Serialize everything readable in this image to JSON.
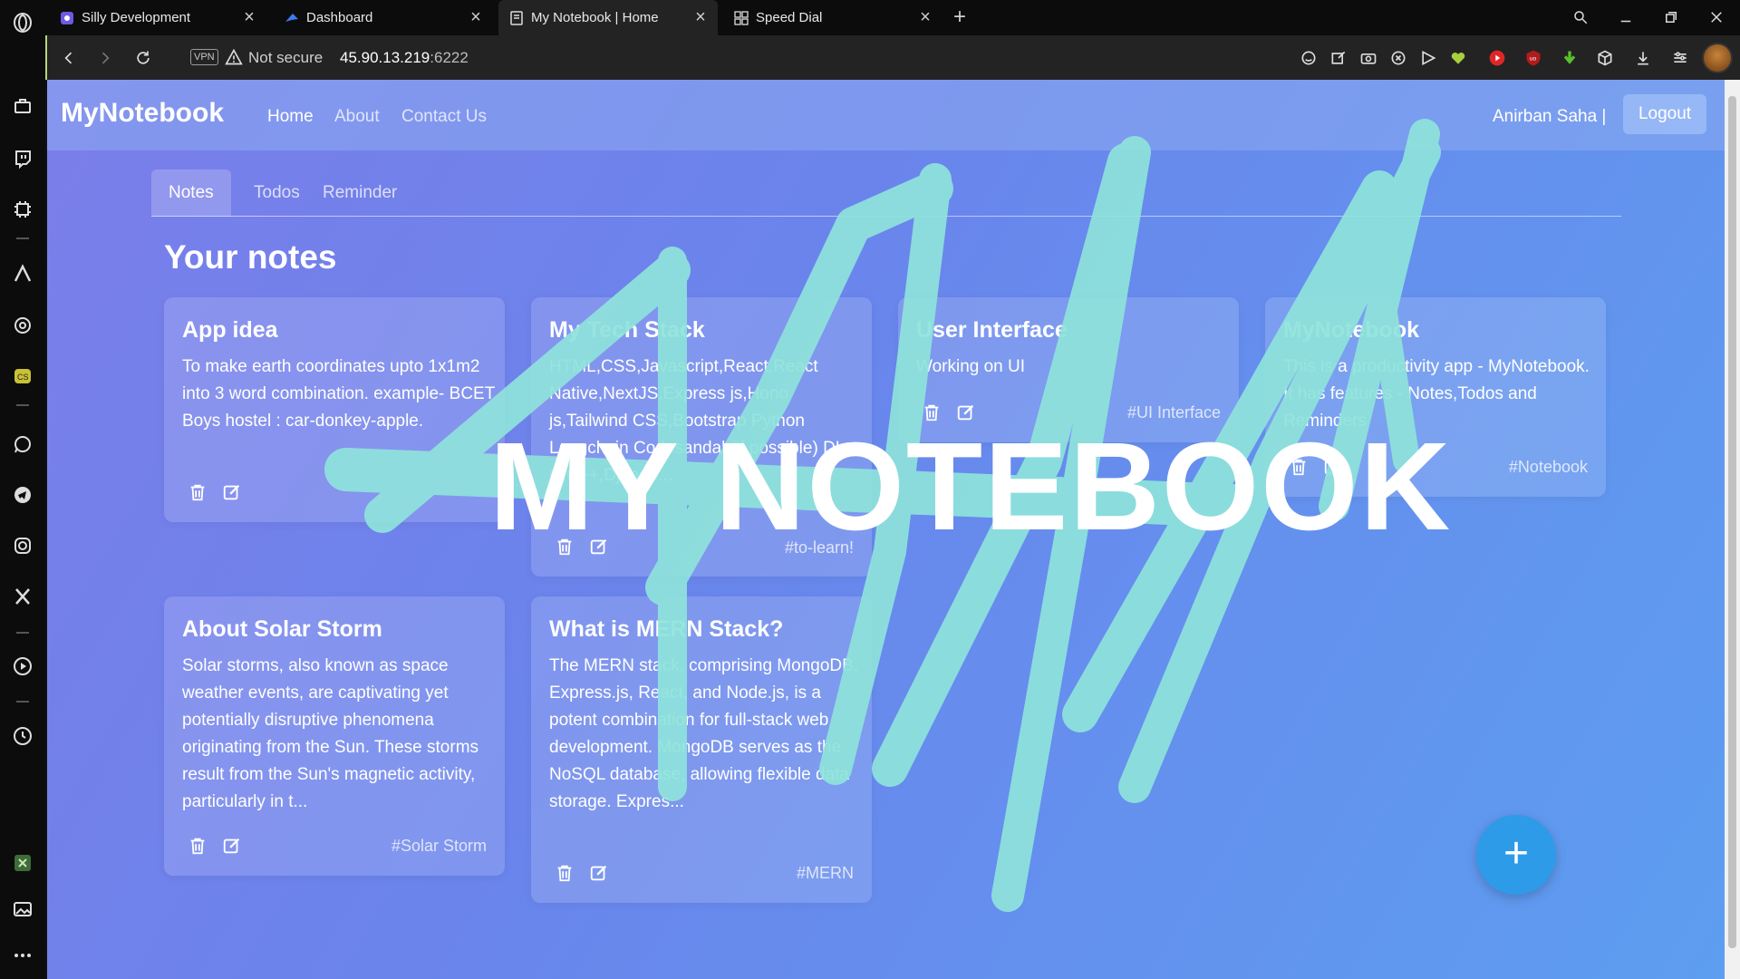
{
  "browser": {
    "tabs": [
      {
        "title": "Silly Development",
        "icon": "silly-icon"
      },
      {
        "title": "Dashboard",
        "icon": "dashboard-icon"
      },
      {
        "title": "My Notebook | Home",
        "icon": "notebook-icon"
      },
      {
        "title": "Speed Dial",
        "icon": "speed-dial-icon"
      }
    ],
    "active_tab_index": 2,
    "vpn_label": "VPN",
    "security_text": "Not secure",
    "url_host": "45.90.13.219",
    "url_port": ":6222"
  },
  "navbar": {
    "brand": "MyNotebook",
    "links": [
      "Home",
      "About",
      "Contact Us"
    ],
    "user": "Anirban Saha |",
    "logout": "Logout"
  },
  "page_tabs": [
    "Notes",
    "Todos",
    "Reminder"
  ],
  "section_title": "Your notes",
  "notes": [
    {
      "title": "App idea",
      "description": "To make earth coordinates upto 1x1m2 into 3 word combination. example- BCET Boys hostel : car-donkey-apple.",
      "tag": ""
    },
    {
      "title": "My Tech Stack",
      "description": "HTML,CSS,Javascript,React,React Native,NextJS,Express js,Hono js,Tailwind CSS,Bootstrap Python Langchain Codesandal (if possible) DL - C,C++,Django...",
      "tag": "#to-learn!"
    },
    {
      "title": "User Interface",
      "description": "Working on UI",
      "tag": "#UI Interface"
    },
    {
      "title": "MyNotebook",
      "description": "This is a productivity app - MyNotebook. It has features - Notes,Todos and Reminders",
      "tag": "#Notebook"
    },
    {
      "title": "About Solar Storm",
      "description": "Solar storms, also known as space weather events, are captivating yet potentially disruptive phenomena originating from the Sun. These storms result from the Sun's magnetic activity, particularly in t...",
      "tag": "#Solar Storm"
    },
    {
      "title": "What is MERN Stack?",
      "description": "The MERN stack, comprising MongoDB, Express.js, React, and Node.js, is a potent combination for full-stack web development. MongoDB serves as the NoSQL database, allowing flexible data storage. Expres...",
      "tag": "#MERN"
    }
  ],
  "fab_label": "+",
  "overlay_text": "MY NOTEBOOK",
  "colors": {
    "accent": "#2e9be8",
    "brush": "#8fe3dc"
  }
}
